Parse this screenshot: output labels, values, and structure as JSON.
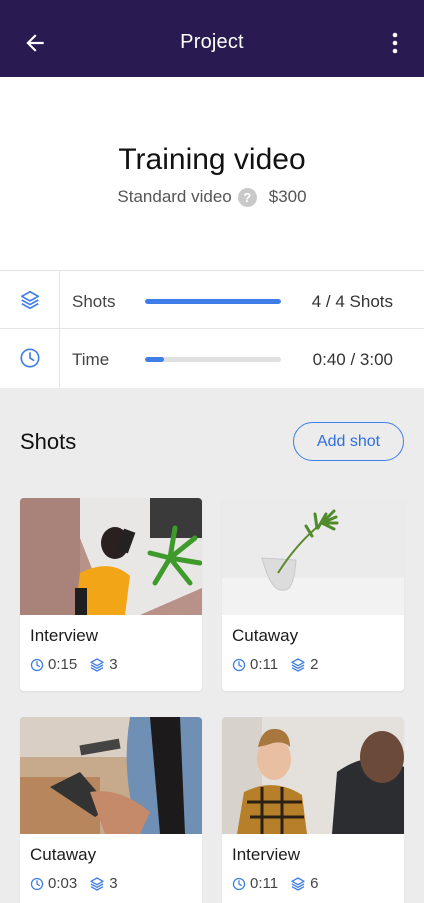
{
  "appbar": {
    "title": "Project",
    "back_icon": "arrow-back-icon",
    "more_icon": "more-vert-icon"
  },
  "project": {
    "name": "Training video",
    "type": "Standard video",
    "price": "$300",
    "help_glyph": "?"
  },
  "stats": {
    "shots": {
      "label": "Shots",
      "value": "4 / 4 Shots",
      "progress": 1.0,
      "icon": "layers-icon"
    },
    "time": {
      "label": "Time",
      "value": "0:40 / 3:00",
      "progress": 0.14,
      "icon": "clock-icon"
    }
  },
  "shots_section": {
    "title": "Shots",
    "add_label": "Add shot"
  },
  "shots": [
    {
      "title": "Interview",
      "duration": "0:15",
      "layers": "3"
    },
    {
      "title": "Cutaway",
      "duration": "0:11",
      "layers": "2"
    },
    {
      "title": "Cutaway",
      "duration": "0:03",
      "layers": "3"
    },
    {
      "title": "Interview",
      "duration": "0:11",
      "layers": "6"
    }
  ],
  "colors": {
    "appbar": "#2a1a52",
    "accent": "#3f7de8",
    "background": "#ececec"
  }
}
